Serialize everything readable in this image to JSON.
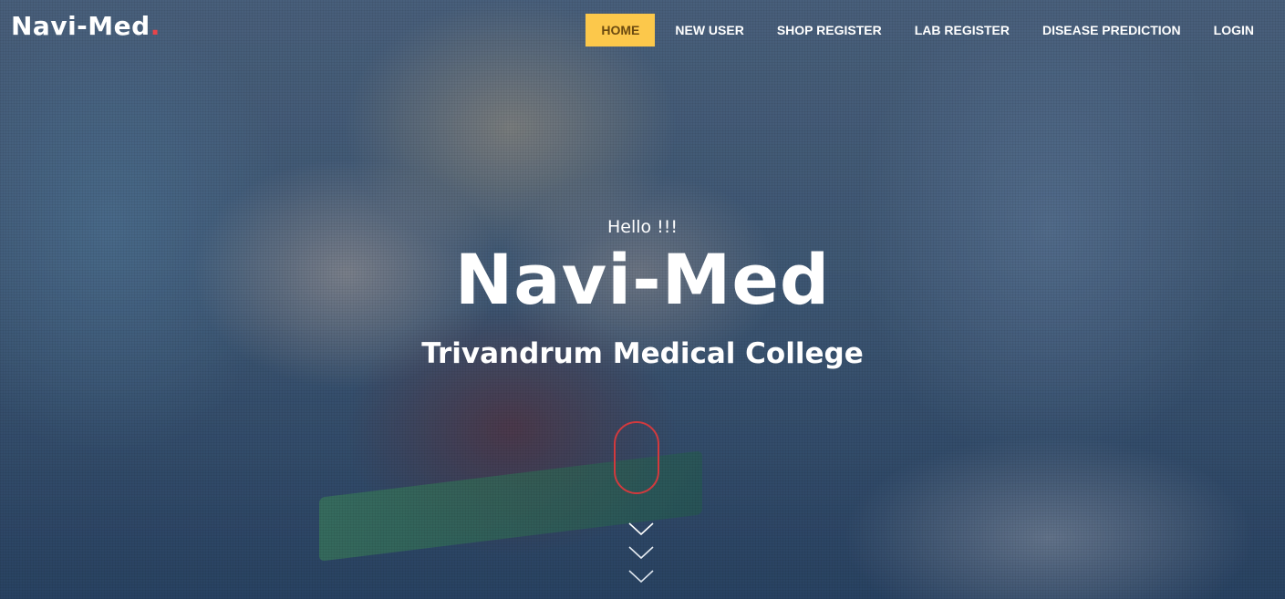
{
  "brand": {
    "name": "Navi-Med",
    "dot": "."
  },
  "nav": {
    "items": [
      {
        "label": "HOME"
      },
      {
        "label": "NEW USER"
      },
      {
        "label": "SHOP REGISTER"
      },
      {
        "label": "LAB REGISTER"
      },
      {
        "label": "DISEASE PREDICTION"
      },
      {
        "label": "LOGIN"
      }
    ]
  },
  "hero": {
    "greeting": "Hello !!!",
    "title": "Navi-Med",
    "subtitle": "Trivandrum Medical College"
  },
  "colors": {
    "accent": "#fcc84b",
    "brand_dot": "#e8444a",
    "scroll_indicator": "#d23a3e"
  },
  "icons": {
    "scroll": "mouse-scroll-icon",
    "chevron": "chevron-down-icon"
  }
}
